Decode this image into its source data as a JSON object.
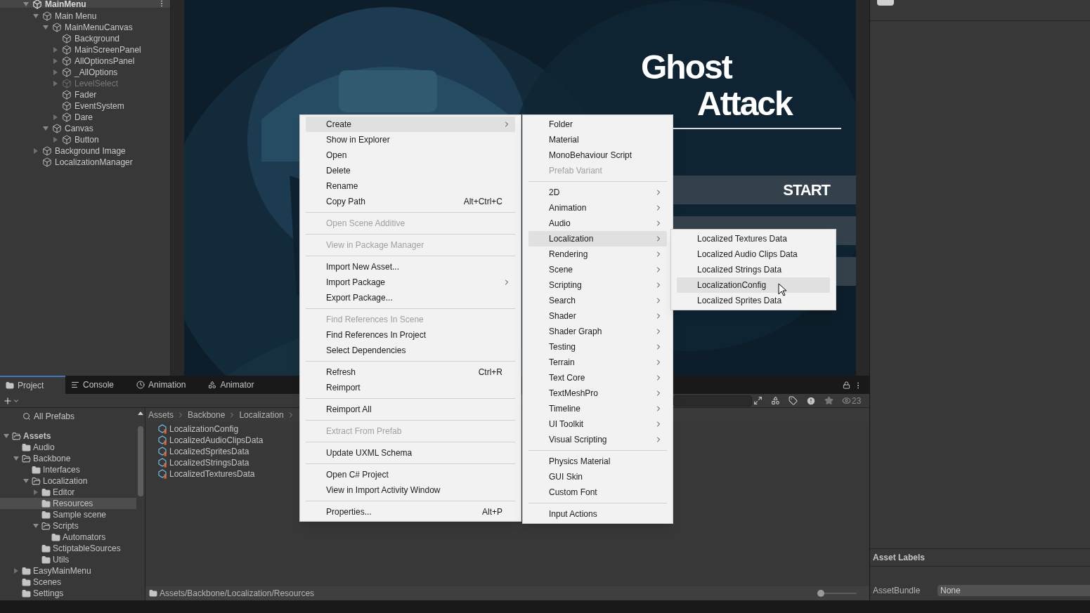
{
  "hierarchy": {
    "scene": "MainMenu",
    "items": [
      {
        "label": "Main Menu",
        "kind": "node",
        "expanded": true,
        "disabled": false,
        "children": [
          {
            "label": "MainMenuCanvas",
            "kind": "node",
            "expanded": true,
            "disabled": false,
            "children": [
              {
                "label": "Background",
                "kind": "leaf",
                "disabled": false
              },
              {
                "label": "MainScreenPanel",
                "kind": "node",
                "expanded": false,
                "disabled": false
              },
              {
                "label": "AllOptionsPanel",
                "kind": "node",
                "expanded": false,
                "disabled": false
              },
              {
                "label": "_AllOptions",
                "kind": "node",
                "expanded": false,
                "disabled": false
              },
              {
                "label": "LevelSelect",
                "kind": "node",
                "expanded": false,
                "disabled": true
              },
              {
                "label": "Fader",
                "kind": "leaf",
                "disabled": false
              },
              {
                "label": "EventSystem",
                "kind": "leaf",
                "disabled": false
              },
              {
                "label": "Dare",
                "kind": "node",
                "expanded": false,
                "disabled": false
              }
            ]
          },
          {
            "label": "Canvas",
            "kind": "node",
            "expanded": true,
            "disabled": false,
            "children": [
              {
                "label": "Button",
                "kind": "node",
                "expanded": false,
                "disabled": false
              }
            ]
          }
        ]
      },
      {
        "label": "Background Image",
        "kind": "node",
        "expanded": false,
        "disabled": false
      },
      {
        "label": "LocalizationManager",
        "kind": "leaf",
        "disabled": false
      }
    ]
  },
  "game_view": {
    "title_lines": [
      "Ghost",
      "Attack"
    ],
    "buttons": [
      {
        "kind": "text",
        "label": "START"
      },
      {
        "kind": "blank"
      },
      {
        "kind": "blank"
      }
    ]
  },
  "project": {
    "tabs": [
      {
        "label": "Project",
        "selected": true
      },
      {
        "label": "Console",
        "selected": false
      },
      {
        "label": "Animation",
        "selected": false
      },
      {
        "label": "Animator",
        "selected": false
      }
    ],
    "count": "23",
    "favorites": "All Prefabs",
    "tree": [
      {
        "label": "Assets",
        "kind": "node",
        "expanded": true,
        "selected": false,
        "children": [
          {
            "label": "Audio",
            "kind": "leaf",
            "selected": false
          },
          {
            "label": "Backbone",
            "kind": "node",
            "expanded": true,
            "selected": false,
            "children": [
              {
                "label": "Interfaces",
                "kind": "leaf",
                "selected": false
              },
              {
                "label": "Localization",
                "kind": "node",
                "expanded": true,
                "selected": false,
                "children": [
                  {
                    "label": "Editor",
                    "kind": "node",
                    "expanded": false,
                    "selected": false
                  },
                  {
                    "label": "Resources",
                    "kind": "leaf",
                    "selected": true
                  },
                  {
                    "label": "Sample scene",
                    "kind": "leaf",
                    "selected": false
                  },
                  {
                    "label": "Scripts",
                    "kind": "node",
                    "expanded": true,
                    "selected": false,
                    "children": [
                      {
                        "label": "Automators",
                        "kind": "leaf",
                        "selected": false
                      }
                    ]
                  },
                  {
                    "label": "SctiptableSources",
                    "kind": "leaf",
                    "selected": false
                  },
                  {
                    "label": "Utils",
                    "kind": "leaf",
                    "selected": false
                  }
                ]
              }
            ]
          },
          {
            "label": "EasyMainMenu",
            "kind": "node",
            "expanded": false,
            "selected": false
          },
          {
            "label": "Scenes",
            "kind": "leaf",
            "selected": false
          },
          {
            "label": "Settings",
            "kind": "leaf",
            "selected": false
          }
        ]
      }
    ],
    "breadcrumb": [
      "Assets",
      "Backbone",
      "Localization"
    ],
    "files": [
      "LocalizationConfig",
      "LocalizedAudioClipsData",
      "LocalizedSpritesData",
      "LocalizedStringsData",
      "LocalizedTexturesData"
    ],
    "path": "Assets/Backbone/Localization/Resources",
    "zoom": {
      "level": 0
    }
  },
  "inspector": {
    "labels_title": "Asset Labels",
    "bundle_label": "AssetBundle",
    "bundle_value": "None"
  },
  "context_menu": {
    "items": [
      {
        "kind": "item",
        "label": "Create",
        "submenu": true,
        "disabled": false,
        "selected": true
      },
      {
        "kind": "item",
        "label": "Show in Explorer",
        "submenu": false,
        "disabled": false,
        "selected": false
      },
      {
        "kind": "item",
        "label": "Open",
        "submenu": false,
        "disabled": false,
        "selected": false
      },
      {
        "kind": "item",
        "label": "Delete",
        "submenu": false,
        "disabled": false,
        "selected": false
      },
      {
        "kind": "item",
        "label": "Rename",
        "submenu": false,
        "disabled": false,
        "selected": false
      },
      {
        "kind": "item",
        "label": "Copy Path",
        "shortcut": "Alt+Ctrl+C",
        "submenu": false,
        "disabled": false,
        "selected": false
      },
      {
        "kind": "separator"
      },
      {
        "kind": "item",
        "label": "Open Scene Additive",
        "submenu": false,
        "disabled": true,
        "selected": false
      },
      {
        "kind": "separator"
      },
      {
        "kind": "item",
        "label": "View in Package Manager",
        "submenu": false,
        "disabled": true,
        "selected": false
      },
      {
        "kind": "separator"
      },
      {
        "kind": "item",
        "label": "Import New Asset...",
        "submenu": false,
        "disabled": false,
        "selected": false
      },
      {
        "kind": "item",
        "label": "Import Package",
        "submenu": true,
        "disabled": false,
        "selected": false
      },
      {
        "kind": "item",
        "label": "Export Package...",
        "submenu": false,
        "disabled": false,
        "selected": false
      },
      {
        "kind": "separator"
      },
      {
        "kind": "item",
        "label": "Find References In Scene",
        "submenu": false,
        "disabled": true,
        "selected": false
      },
      {
        "kind": "item",
        "label": "Find References In Project",
        "submenu": false,
        "disabled": false,
        "selected": false
      },
      {
        "kind": "item",
        "label": "Select Dependencies",
        "submenu": false,
        "disabled": false,
        "selected": false
      },
      {
        "kind": "separator"
      },
      {
        "kind": "item",
        "label": "Refresh",
        "shortcut": "Ctrl+R",
        "submenu": false,
        "disabled": false,
        "selected": false
      },
      {
        "kind": "item",
        "label": "Reimport",
        "submenu": false,
        "disabled": false,
        "selected": false
      },
      {
        "kind": "separator"
      },
      {
        "kind": "item",
        "label": "Reimport All",
        "submenu": false,
        "disabled": false,
        "selected": false
      },
      {
        "kind": "separator"
      },
      {
        "kind": "item",
        "label": "Extract From Prefab",
        "submenu": false,
        "disabled": true,
        "selected": false
      },
      {
        "kind": "separator"
      },
      {
        "kind": "item",
        "label": "Update UXML Schema",
        "submenu": false,
        "disabled": false,
        "selected": false
      },
      {
        "kind": "separator"
      },
      {
        "kind": "item",
        "label": "Open C# Project",
        "submenu": false,
        "disabled": false,
        "selected": false
      },
      {
        "kind": "item",
        "label": "View in Import Activity Window",
        "submenu": false,
        "disabled": false,
        "selected": false
      },
      {
        "kind": "separator"
      },
      {
        "kind": "item",
        "label": "Properties...",
        "shortcut": "Alt+P",
        "submenu": false,
        "disabled": false,
        "selected": false
      }
    ]
  },
  "create_menu": {
    "items": [
      {
        "kind": "item",
        "label": "Folder",
        "submenu": false,
        "disabled": false,
        "selected": false
      },
      {
        "kind": "item",
        "label": "Material",
        "submenu": false,
        "disabled": false,
        "selected": false
      },
      {
        "kind": "item",
        "label": "MonoBehaviour Script",
        "submenu": false,
        "disabled": false,
        "selected": false
      },
      {
        "kind": "item",
        "label": "Prefab Variant",
        "submenu": false,
        "disabled": true,
        "selected": false
      },
      {
        "kind": "separator"
      },
      {
        "kind": "item",
        "label": "2D",
        "submenu": true,
        "disabled": false,
        "selected": false
      },
      {
        "kind": "item",
        "label": "Animation",
        "submenu": true,
        "disabled": false,
        "selected": false
      },
      {
        "kind": "item",
        "label": "Audio",
        "submenu": true,
        "disabled": false,
        "selected": false
      },
      {
        "kind": "item",
        "label": "Localization",
        "submenu": true,
        "disabled": false,
        "selected": true
      },
      {
        "kind": "item",
        "label": "Rendering",
        "submenu": true,
        "disabled": false,
        "selected": false
      },
      {
        "kind": "item",
        "label": "Scene",
        "submenu": true,
        "disabled": false,
        "selected": false
      },
      {
        "kind": "item",
        "label": "Scripting",
        "submenu": true,
        "disabled": false,
        "selected": false
      },
      {
        "kind": "item",
        "label": "Search",
        "submenu": true,
        "disabled": false,
        "selected": false
      },
      {
        "kind": "item",
        "label": "Shader",
        "submenu": true,
        "disabled": false,
        "selected": false
      },
      {
        "kind": "item",
        "label": "Shader Graph",
        "submenu": true,
        "disabled": false,
        "selected": false
      },
      {
        "kind": "item",
        "label": "Testing",
        "submenu": true,
        "disabled": false,
        "selected": false
      },
      {
        "kind": "item",
        "label": "Terrain",
        "submenu": true,
        "disabled": false,
        "selected": false
      },
      {
        "kind": "item",
        "label": "Text Core",
        "submenu": true,
        "disabled": false,
        "selected": false
      },
      {
        "kind": "item",
        "label": "TextMeshPro",
        "submenu": true,
        "disabled": false,
        "selected": false
      },
      {
        "kind": "item",
        "label": "Timeline",
        "submenu": true,
        "disabled": false,
        "selected": false
      },
      {
        "kind": "item",
        "label": "UI Toolkit",
        "submenu": true,
        "disabled": false,
        "selected": false
      },
      {
        "kind": "item",
        "label": "Visual Scripting",
        "submenu": true,
        "disabled": false,
        "selected": false
      },
      {
        "kind": "separator"
      },
      {
        "kind": "item",
        "label": "Physics Material",
        "submenu": false,
        "disabled": false,
        "selected": false
      },
      {
        "kind": "item",
        "label": "GUI Skin",
        "submenu": false,
        "disabled": false,
        "selected": false
      },
      {
        "kind": "item",
        "label": "Custom Font",
        "submenu": false,
        "disabled": false,
        "selected": false
      },
      {
        "kind": "separator"
      },
      {
        "kind": "item",
        "label": "Input Actions",
        "submenu": false,
        "disabled": false,
        "selected": false
      }
    ]
  },
  "localization_menu": {
    "items": [
      {
        "kind": "item",
        "label": "Localized Textures Data",
        "submenu": false,
        "disabled": false,
        "selected": false
      },
      {
        "kind": "item",
        "label": "Localized Audio Clips Data",
        "submenu": false,
        "disabled": false,
        "selected": false
      },
      {
        "kind": "item",
        "label": "Localized Strings Data",
        "submenu": false,
        "disabled": false,
        "selected": false
      },
      {
        "kind": "item",
        "label": "LocalizationConfig",
        "submenu": false,
        "disabled": false,
        "selected": true
      },
      {
        "kind": "item",
        "label": "Localized Sprites Data",
        "submenu": false,
        "disabled": false,
        "selected": false
      }
    ]
  }
}
